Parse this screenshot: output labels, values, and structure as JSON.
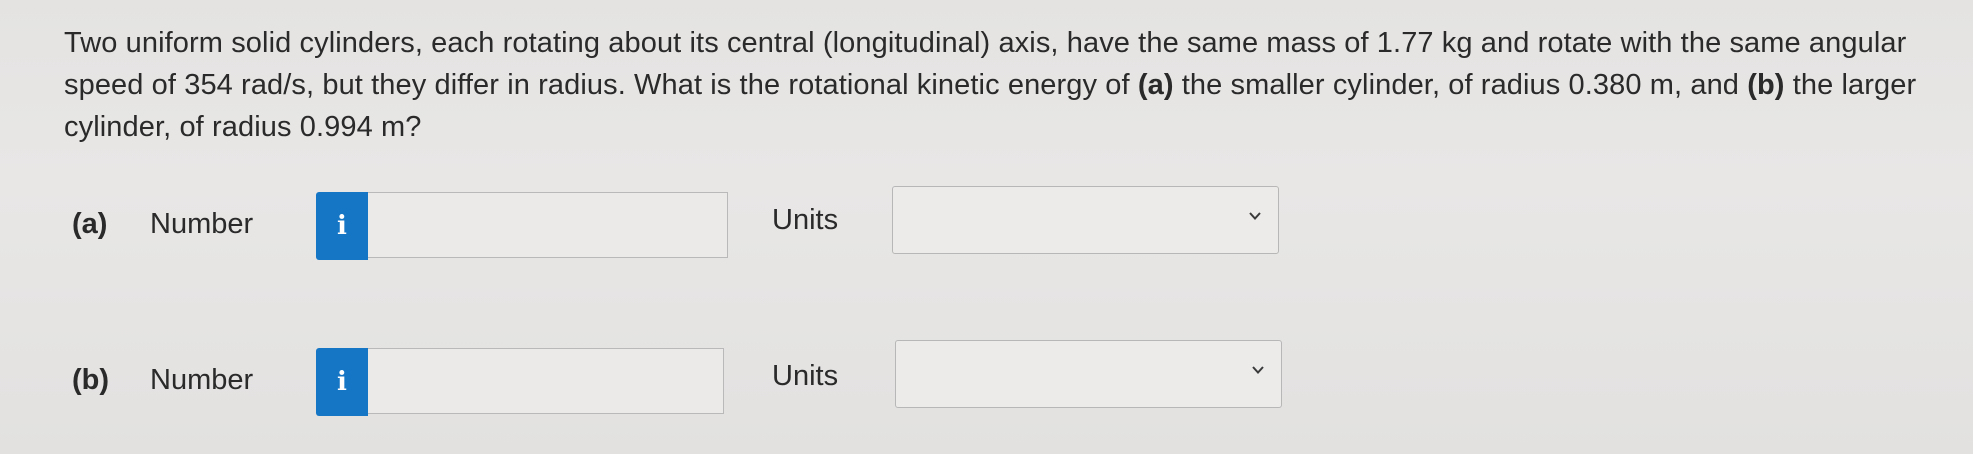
{
  "question": {
    "text_1": "Two uniform solid cylinders, each rotating about its central (longitudinal) axis, have the same mass of 1.77 kg and rotate with the same angular speed of 354 rad/s, but they differ in radius. What is the rotational kinetic energy of ",
    "part_a_ref": "(a)",
    "text_2": " the smaller cylinder, of radius 0.380 m, and ",
    "part_b_ref": "(b)",
    "text_3": " the larger cylinder, of radius 0.994 m?"
  },
  "parts": {
    "a": {
      "label": "(a)",
      "number_label": "Number",
      "info_icon": "info-icon",
      "number_value": "",
      "units_label": "Units",
      "units_selected": ""
    },
    "b": {
      "label": "(b)",
      "number_label": "Number",
      "info_icon": "info-icon",
      "number_value": "",
      "units_label": "Units",
      "units_selected": ""
    }
  },
  "icons": {
    "info_glyph": "i",
    "dropdown": "chevron-down-icon"
  },
  "colors": {
    "info_button": "#1676c6",
    "background": "#e6e5e4",
    "text": "#2a2a2a"
  }
}
